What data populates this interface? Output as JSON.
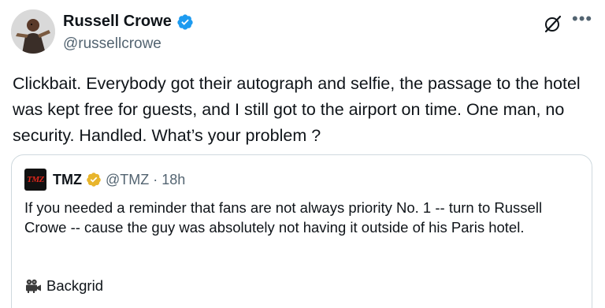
{
  "author": {
    "name": "Russell Crowe",
    "handle": "@russellcrowe"
  },
  "tweet": {
    "text": "Clickbait. Everybody got their autograph and selfie, the passage to the hotel was kept free for guests, and I still got to the airport on time. One man, no security. Handled. What’s your problem ?"
  },
  "quoted_tweet": {
    "logo_text": "TMZ",
    "name": "TMZ",
    "handle": "@TMZ",
    "separator": "·",
    "time": "18h",
    "text": "If you needed a reminder that fans are not always priority No. 1 -- turn to Russell Crowe -- cause the guy was absolutely not having it outside of his Paris hotel.",
    "credit": "Backgrid"
  },
  "icons": {
    "verified": "verified-badge-icon",
    "gold_verified": "gold-verified-badge-icon",
    "grok": "grok-icon",
    "more": "more-icon",
    "camera": "movie-camera-icon"
  },
  "colors": {
    "text_primary": "#0f1419",
    "text_secondary": "#536471",
    "verified_blue": "#1d9bf0",
    "verified_gold": "#e8b52c",
    "border": "#cfd9de"
  }
}
